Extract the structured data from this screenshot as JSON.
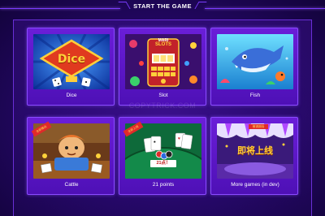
{
  "header": {
    "title": "START THE GAME"
  },
  "games": [
    {
      "label": "Dice",
      "logo": "Dice"
    },
    {
      "label": "Slot",
      "logo_top": "MARI",
      "logo_bottom": "SLOTS"
    },
    {
      "label": "Fish"
    },
    {
      "label": "Cattle",
      "ribbon": "全新推出"
    },
    {
      "label": "21 points",
      "ribbon": "全新上线",
      "banner": "21点！"
    },
    {
      "label": "More games (in dev)",
      "ribbon": "敬请期待",
      "headline": "即将上线"
    }
  ],
  "watermark": "COPYTRICK.COM",
  "colors": {
    "accent": "#7b3cff",
    "card": "#5a18c8",
    "background": "#26086a"
  }
}
